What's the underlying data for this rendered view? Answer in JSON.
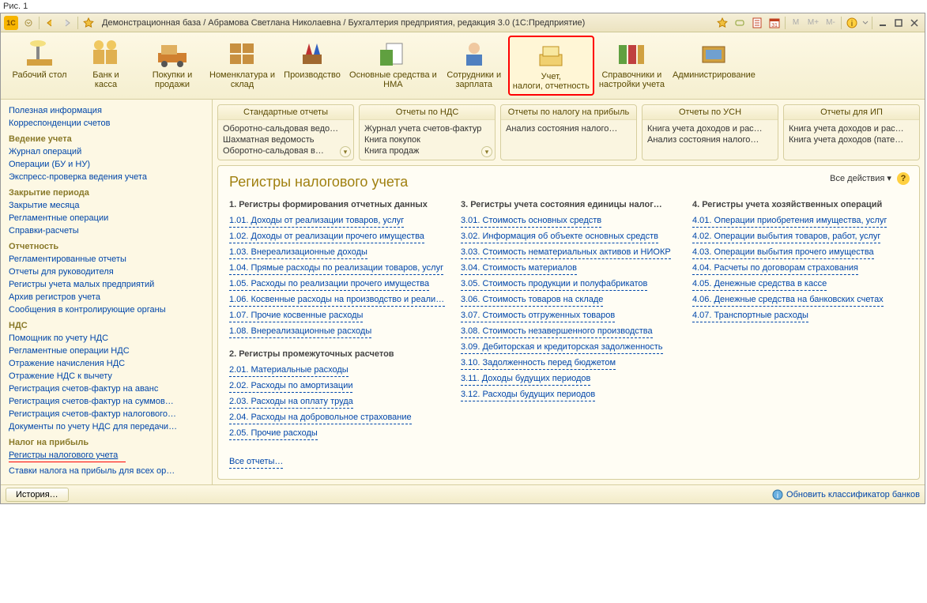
{
  "figure_label": "Рис. 1",
  "titlebar": {
    "text": "Демонстрационная база / Абрамова Светлана Николаевна / Бухгалтерия предприятия, редакция 3.0   (1С:Предприятие)"
  },
  "toolbar": [
    {
      "label": "Рабочий стол"
    },
    {
      "label": "Банк и касса"
    },
    {
      "label": "Покупки и продажи"
    },
    {
      "label": "Номенклатура и склад"
    },
    {
      "label": "Производство"
    },
    {
      "label": "Основные средства и НМА"
    },
    {
      "label": "Сотрудники и зарплата"
    },
    {
      "label": "Учет, налоги, отчетность",
      "selected": true
    },
    {
      "label": "Справочники и настройки учета"
    },
    {
      "label": "Администрирование"
    }
  ],
  "sidebar": [
    {
      "type": "link",
      "label": "Полезная информация"
    },
    {
      "type": "link",
      "label": "Корреспонденции счетов"
    },
    {
      "type": "header",
      "label": "Ведение учета"
    },
    {
      "type": "link",
      "label": "Журнал операций"
    },
    {
      "type": "link",
      "label": "Операции (БУ и НУ)"
    },
    {
      "type": "link",
      "label": "Экспресс-проверка ведения учета"
    },
    {
      "type": "header",
      "label": "Закрытие периода"
    },
    {
      "type": "link",
      "label": "Закрытие месяца"
    },
    {
      "type": "link",
      "label": "Регламентные операции"
    },
    {
      "type": "link",
      "label": "Справки-расчеты"
    },
    {
      "type": "header",
      "label": "Отчетность"
    },
    {
      "type": "link",
      "label": "Регламентированные отчеты"
    },
    {
      "type": "link",
      "label": "Отчеты для руководителя"
    },
    {
      "type": "link",
      "label": "Регистры учета малых предприятий"
    },
    {
      "type": "link",
      "label": "Архив регистров учета"
    },
    {
      "type": "link",
      "label": "Сообщения в контролирующие органы"
    },
    {
      "type": "header",
      "label": "НДС"
    },
    {
      "type": "link",
      "label": "Помощник по учету НДС"
    },
    {
      "type": "link",
      "label": "Регламентные операции НДС"
    },
    {
      "type": "link",
      "label": "Отражение начисления НДС"
    },
    {
      "type": "link",
      "label": "Отражение НДС к вычету"
    },
    {
      "type": "link",
      "label": "Регистрация счетов-фактур на аванс"
    },
    {
      "type": "link",
      "label": "Регистрация счетов-фактур на суммов…"
    },
    {
      "type": "link",
      "label": "Регистрация счетов-фактур налогового…"
    },
    {
      "type": "link",
      "label": "Документы по учету НДС для передачи…"
    },
    {
      "type": "header",
      "label": "Налог на прибыль"
    },
    {
      "type": "link",
      "label": "Регистры налогового учета",
      "selected": true
    },
    {
      "type": "link",
      "label": "Ставки налога на прибыль для всех ор…"
    }
  ],
  "report_boxes": [
    {
      "title": "Стандартные отчеты",
      "items": [
        "Оборотно-сальдовая ведо…",
        "Шахматная ведомость",
        "Оборотно-сальдовая в…"
      ],
      "chevron": true
    },
    {
      "title": "Отчеты по НДС",
      "items": [
        "Журнал учета счетов-фактур",
        "Книга покупок",
        "Книга продаж"
      ],
      "chevron": true
    },
    {
      "title": "Отчеты по налогу на прибыль",
      "items": [
        "Анализ состояния налого…"
      ]
    },
    {
      "title": "Отчеты по УСН",
      "items": [
        "Книга учета доходов и рас…",
        "Анализ состояния налого…"
      ]
    },
    {
      "title": "Отчеты для ИП",
      "items": [
        "Книга учета доходов и рас…",
        "Книга учета доходов (пате…"
      ]
    }
  ],
  "content": {
    "title": "Регистры налогового учета",
    "all_actions": "Все действия",
    "all_reports": "Все отчеты…",
    "columns": [
      {
        "header": "1.  Регистры формирования отчетных данных",
        "links": [
          "1.01. Доходы от реализации товаров, услуг",
          "1.02. Доходы от реализации прочего имущества",
          "1.03. Внереализационные доходы",
          "1.04. Прямые расходы по реализации товаров, услуг",
          "1.05. Расходы по реализации прочего имущества",
          "1.06. Косвенные расходы на производство и реализа…",
          "1.07. Прочие косвенные расходы",
          "1.08. Внереализационные расходы"
        ],
        "header2": "2.  Регистры промежуточных расчетов",
        "links2": [
          "2.01. Материальные расходы",
          "2.02. Расходы по амортизации",
          "2.03. Расходы на оплату труда",
          "2.04. Расходы на добровольное страхование",
          "2.05. Прочие расходы"
        ]
      },
      {
        "header": "3.  Регистры учета состояния единицы налог…",
        "links": [
          "3.01. Стоимость основных средств",
          "3.02. Информация об объекте основных средств",
          "3.03. Стоимость нематериальных активов и НИОКР",
          "3.04. Стоимость материалов",
          "3.05. Стоимость продукции и полуфабрикатов",
          "3.06. Стоимость товаров на складе",
          "3.07. Стоимость отгруженных товаров",
          "3.08. Стоимость незавершенного производства",
          "3.09. Дебиторская и кредиторская задолженность",
          "3.10. Задолженность перед бюджетом",
          "3.11. Доходы будущих периодов",
          "3.12. Расходы будущих периодов"
        ]
      },
      {
        "header": "4.  Регистры учета хозяйственных операций",
        "links": [
          "4.01. Операции приобретения имущества, услуг",
          "4.02. Операции выбытия товаров, работ, услуг",
          "4.03. Операции выбытия прочего имущества",
          "4.04. Расчеты по договорам страхования",
          "4.05. Денежные средства в кассе",
          "4.06. Денежные средства на банковских счетах",
          "4.07. Транспортные расходы"
        ]
      }
    ]
  },
  "statusbar": {
    "history": "История…",
    "update_link": "Обновить классификатор банков"
  }
}
